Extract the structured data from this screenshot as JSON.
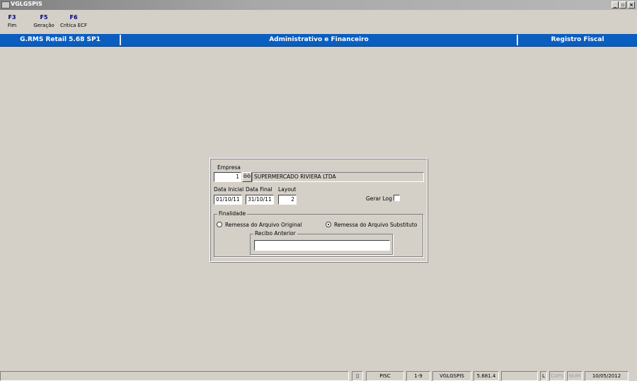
{
  "window": {
    "title": "VGLGSPIS",
    "minimize": "_",
    "restore": "▫",
    "close": "×"
  },
  "fkeys": [
    {
      "key": "F3",
      "label": "Fim"
    },
    {
      "key": "F5",
      "label": "Geração"
    },
    {
      "key": "F6",
      "label": "Crítica ECF"
    }
  ],
  "header": {
    "product": "G.RMS Retail 5.68 SP1",
    "module": "Administrativo e Financeiro",
    "screen": "Registro Fiscal"
  },
  "form": {
    "empresa_label": "Empresa",
    "empresa_code": "1",
    "lookup_icon": "binoculars-icon",
    "empresa_name": "SUPERMERCADO RIVIERA LTDA",
    "data_inicial_label": "Data Inicial",
    "data_inicial": "01/10/11",
    "data_final_label": "Data Final",
    "data_final": "31/10/11",
    "layout_label": "Layout",
    "layout": "2",
    "gerar_log_label": "Gerar Log",
    "gerar_log_checked": false,
    "finalidade_label": "Finalidade",
    "radio_original": "Remessa do Arquivo Original",
    "radio_substituto": "Remessa do Arquivo Substituto",
    "selected": "substituto",
    "recibo_label": "Recibo Anterior",
    "recibo_value": ""
  },
  "status": {
    "icon": "clipboard-icon",
    "app": "PISC",
    "page": "1-9",
    "program": "VGLGSPIS",
    "version": "5.681.4",
    "l": "L",
    "caps": "CAPS",
    "num": "NUM",
    "date": "10/05/2012"
  },
  "colors": {
    "header_bar": "#0a5ec0",
    "background": "#d4d0c8",
    "fkey_text": "#000080"
  }
}
